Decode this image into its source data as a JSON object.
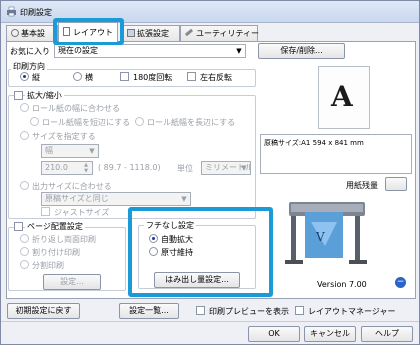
{
  "window": {
    "title": "印刷設定"
  },
  "tabs": [
    {
      "label": "基本設"
    },
    {
      "label": "レイアウト"
    },
    {
      "label": "拡張設定"
    },
    {
      "label": "ユーティリティー"
    }
  ],
  "favorites": {
    "label": "お気に入り",
    "value": "現在の設定",
    "save_button": "保存/削除..."
  },
  "orientation": {
    "title": "印刷方向",
    "portrait": "縦",
    "landscape": "横",
    "rotate180": "180度回転",
    "mirror": "左右反転"
  },
  "scale": {
    "title": "拡大/縮小",
    "fit_roll": "ロール紙の幅に合わせる",
    "short_side": "ロール紙幅を短辺にする",
    "long_side": "ロール紙幅を長辺にする",
    "specify_size": "サイズを指定する",
    "dimension_value": "幅",
    "size_value": "210.0",
    "size_range": "( 89.7 - 1118.0)",
    "unit_label": "単位",
    "unit_value": "ミリメートル",
    "fit_output": "出力サイズに合わせる",
    "output_value": "原稿サイズと同じ",
    "just_size": "ジャストサイズ"
  },
  "page_layout": {
    "title": "ページ配置設定",
    "fold": "折り返し両面印刷",
    "split": "割り付け印刷",
    "tile": "分割印刷",
    "settings_button": "設定..."
  },
  "borderless": {
    "title": "フチなし設定",
    "auto_enlarge": "自動拡大",
    "keep_size": "原寸維持",
    "overflow_button": "はみ出し量設定..."
  },
  "preview": {
    "letter": "A",
    "paper_size": "原稿サイズ:A1 594 x 841 mm",
    "remaining_label": "用紙残量",
    "version": "Version 7.00"
  },
  "bottom": {
    "defaults_button": "初期設定に戻す",
    "settings_list_button": "設定一覧...",
    "print_preview": "印刷プレビューを表示",
    "layout_manager": "レイアウトマネージャー"
  },
  "dialog": {
    "ok": "OK",
    "cancel": "キャンセル",
    "help": "ヘルプ"
  },
  "colors": {
    "highlight": "#1a9ad6",
    "radio_selected": "#1f3a93"
  }
}
